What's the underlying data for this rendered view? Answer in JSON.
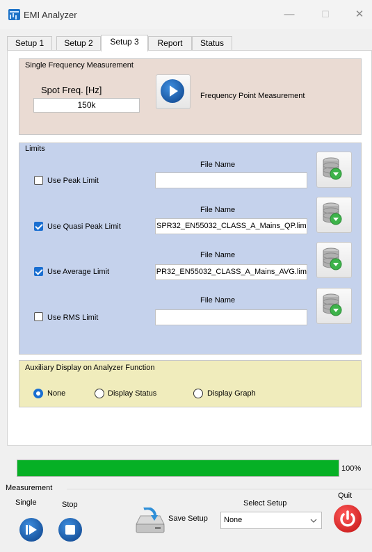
{
  "window": {
    "title": "EMI Analyzer",
    "minimize_glyph": "—",
    "maximize_glyph": "☐",
    "close_glyph": "✕"
  },
  "tabs": [
    {
      "label": "Setup 1"
    },
    {
      "label": "Setup 2"
    },
    {
      "label": "Setup 3",
      "active": true
    },
    {
      "label": "Report"
    },
    {
      "label": "Status"
    }
  ],
  "single_freq": {
    "group_title": "Single Frequency Measurement",
    "spot_label": "Spot Freq. [Hz]",
    "spot_value": "150k",
    "button_label": "Frequency Point Measurement"
  },
  "limits": {
    "group_title": "Limits",
    "file_name_label": "File Name",
    "rows": [
      {
        "label": "Use Peak Limit",
        "checked": false,
        "file": ""
      },
      {
        "label": "Use Quasi Peak Limit",
        "checked": true,
        "file": "SPR32_EN55032_CLASS_A_Mains_QP.lim"
      },
      {
        "label": "Use Average Limit",
        "checked": true,
        "file": "PR32_EN55032_CLASS_A_Mains_AVG.lim"
      },
      {
        "label": "Use RMS Limit",
        "checked": false,
        "file": ""
      }
    ]
  },
  "aux": {
    "group_title": "Auxiliary Display on Analyzer Function",
    "options": [
      {
        "label": "None",
        "selected": true
      },
      {
        "label": "Display Status",
        "selected": false
      },
      {
        "label": "Display Graph",
        "selected": false
      }
    ]
  },
  "progress": {
    "value": 1.0,
    "label": "100%"
  },
  "measurement": {
    "group_title": "Measurement",
    "single_label": "Single",
    "stop_label": "Stop",
    "save_label": "Save Setup",
    "select_setup_label": "Select Setup",
    "select_value": "None",
    "quit_label": "Quit"
  },
  "colors": {
    "accent": "#1a6fd1",
    "progress_green": "#06b025",
    "single_panel": "#eadbd3",
    "limits_panel": "#c5d2ec",
    "aux_panel": "#f0ecbc",
    "quit_red": "#e02424"
  },
  "icons": {
    "app": "emi-analyzer-app-icon",
    "play": "play-icon",
    "database": "database-download-icon",
    "single": "skip-play-icon",
    "stop": "stop-icon",
    "save": "save-drive-icon",
    "quit": "power-icon",
    "dropdown": "chevron-down-icon"
  }
}
